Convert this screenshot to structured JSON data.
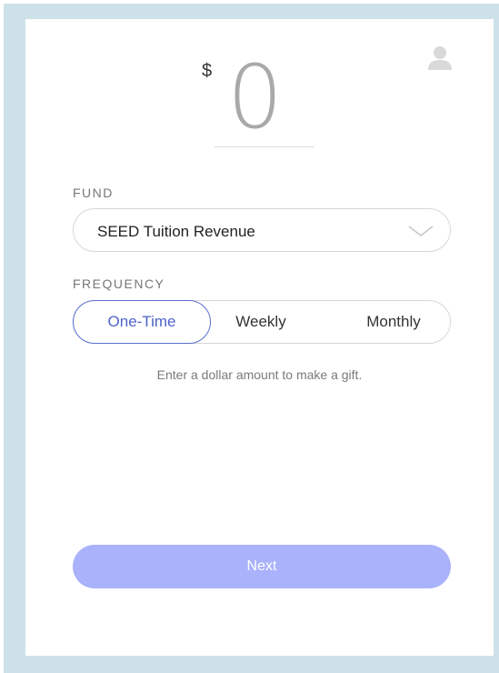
{
  "amount": {
    "currency_symbol": "$",
    "value": "0"
  },
  "icons": {
    "user": "user-icon",
    "dropdown": "chevron-down-icon"
  },
  "fund": {
    "label": "FUND",
    "selected": "SEED Tuition Revenue"
  },
  "frequency": {
    "label": "FREQUENCY",
    "options": [
      "One-Time",
      "Weekly",
      "Monthly"
    ],
    "selected": "One-Time"
  },
  "hint": "Enter a dollar amount to make a gift.",
  "next_label": "Next",
  "colors": {
    "frame": "#cde2e8",
    "accent": "#5a6fd0",
    "button": "#a9b2fa"
  }
}
